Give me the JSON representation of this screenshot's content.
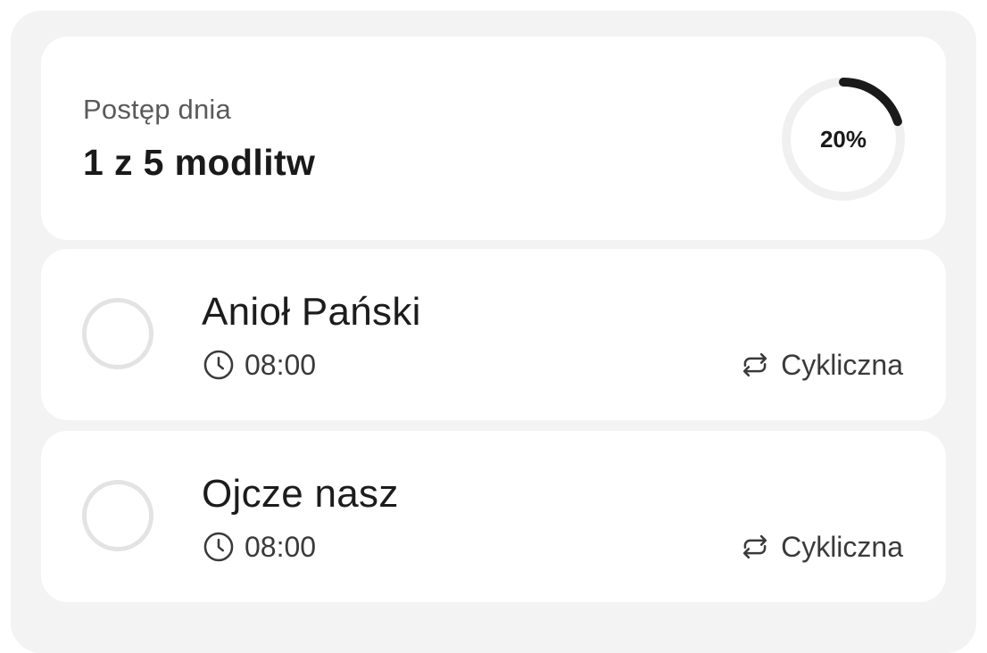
{
  "progress": {
    "caption": "Postęp dnia",
    "count_label": "1 z 5 modlitw",
    "percent_label": "20%",
    "fraction": 0.2
  },
  "prayers": [
    {
      "title": "Anioł Pański",
      "time": "08:00",
      "recurrence": "Cykliczna",
      "done": false,
      "icon_time": "clock-icon",
      "icon_recurrence": "repeat-icon"
    },
    {
      "title": "Ojcze nasz",
      "time": "08:00",
      "recurrence": "Cykliczna",
      "done": false,
      "icon_time": "clock-icon",
      "icon_recurrence": "repeat-icon"
    }
  ],
  "colors": {
    "ring_track": "#f0f0f0",
    "ring_progress": "#1a1a1a",
    "panel_bg": "#f3f3f3"
  }
}
